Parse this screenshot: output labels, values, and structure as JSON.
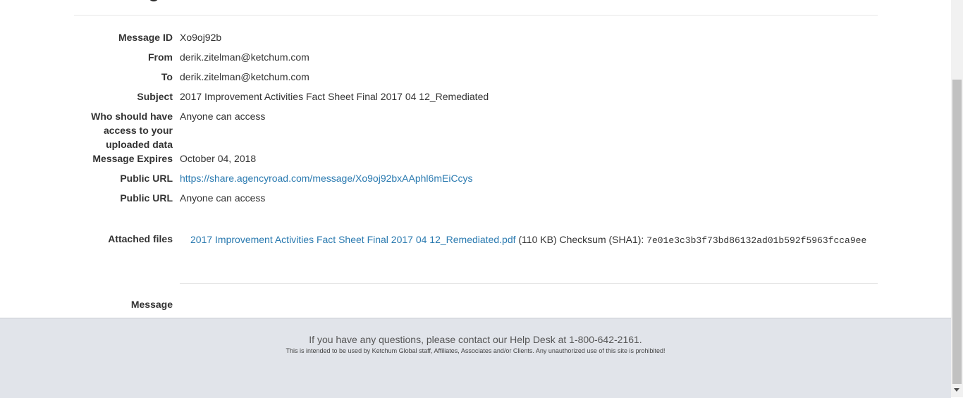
{
  "fields": [
    {
      "label": "Message ID",
      "value": "Xo9oj92b"
    },
    {
      "label": "From",
      "value": "derik.zitelman@ketchum.com"
    },
    {
      "label": "To",
      "value": "derik.zitelman@ketchum.com"
    },
    {
      "label": "Subject",
      "value": "2017 Improvement Activities Fact Sheet Final 2017 04 12_Remediated"
    },
    {
      "label": "Who should have access to your uploaded data",
      "value": "Anyone can access"
    },
    {
      "label": "Message Expires",
      "value": "October 04, 2018"
    },
    {
      "label": "Public URL",
      "value": "https://share.agencyroad.com/message/Xo9oj92bxAAphl6mEiCcys"
    },
    {
      "label": "Public URL",
      "value": "Anyone can access"
    }
  ],
  "attachments": {
    "label": "Attached files",
    "file_name": "2017 Improvement Activities Fact Sheet Final 2017 04 12_Remediated.pdf",
    "size": "(110 KB)",
    "checksum_label": "Checksum (SHA1):",
    "checksum": "7e01e3c3b3f73bd86132ad01b592f5963fcca9ee"
  },
  "message": {
    "label": "Message",
    "body": ""
  },
  "footer": {
    "contact": "If you have any questions, please contact our Help Desk at 1-800-642-2161.",
    "notice": "This is intended to be used by Ketchum Global staff, Affiliates, Associates and/or Clients. Any unauthorized use of this site is prohibited!"
  }
}
